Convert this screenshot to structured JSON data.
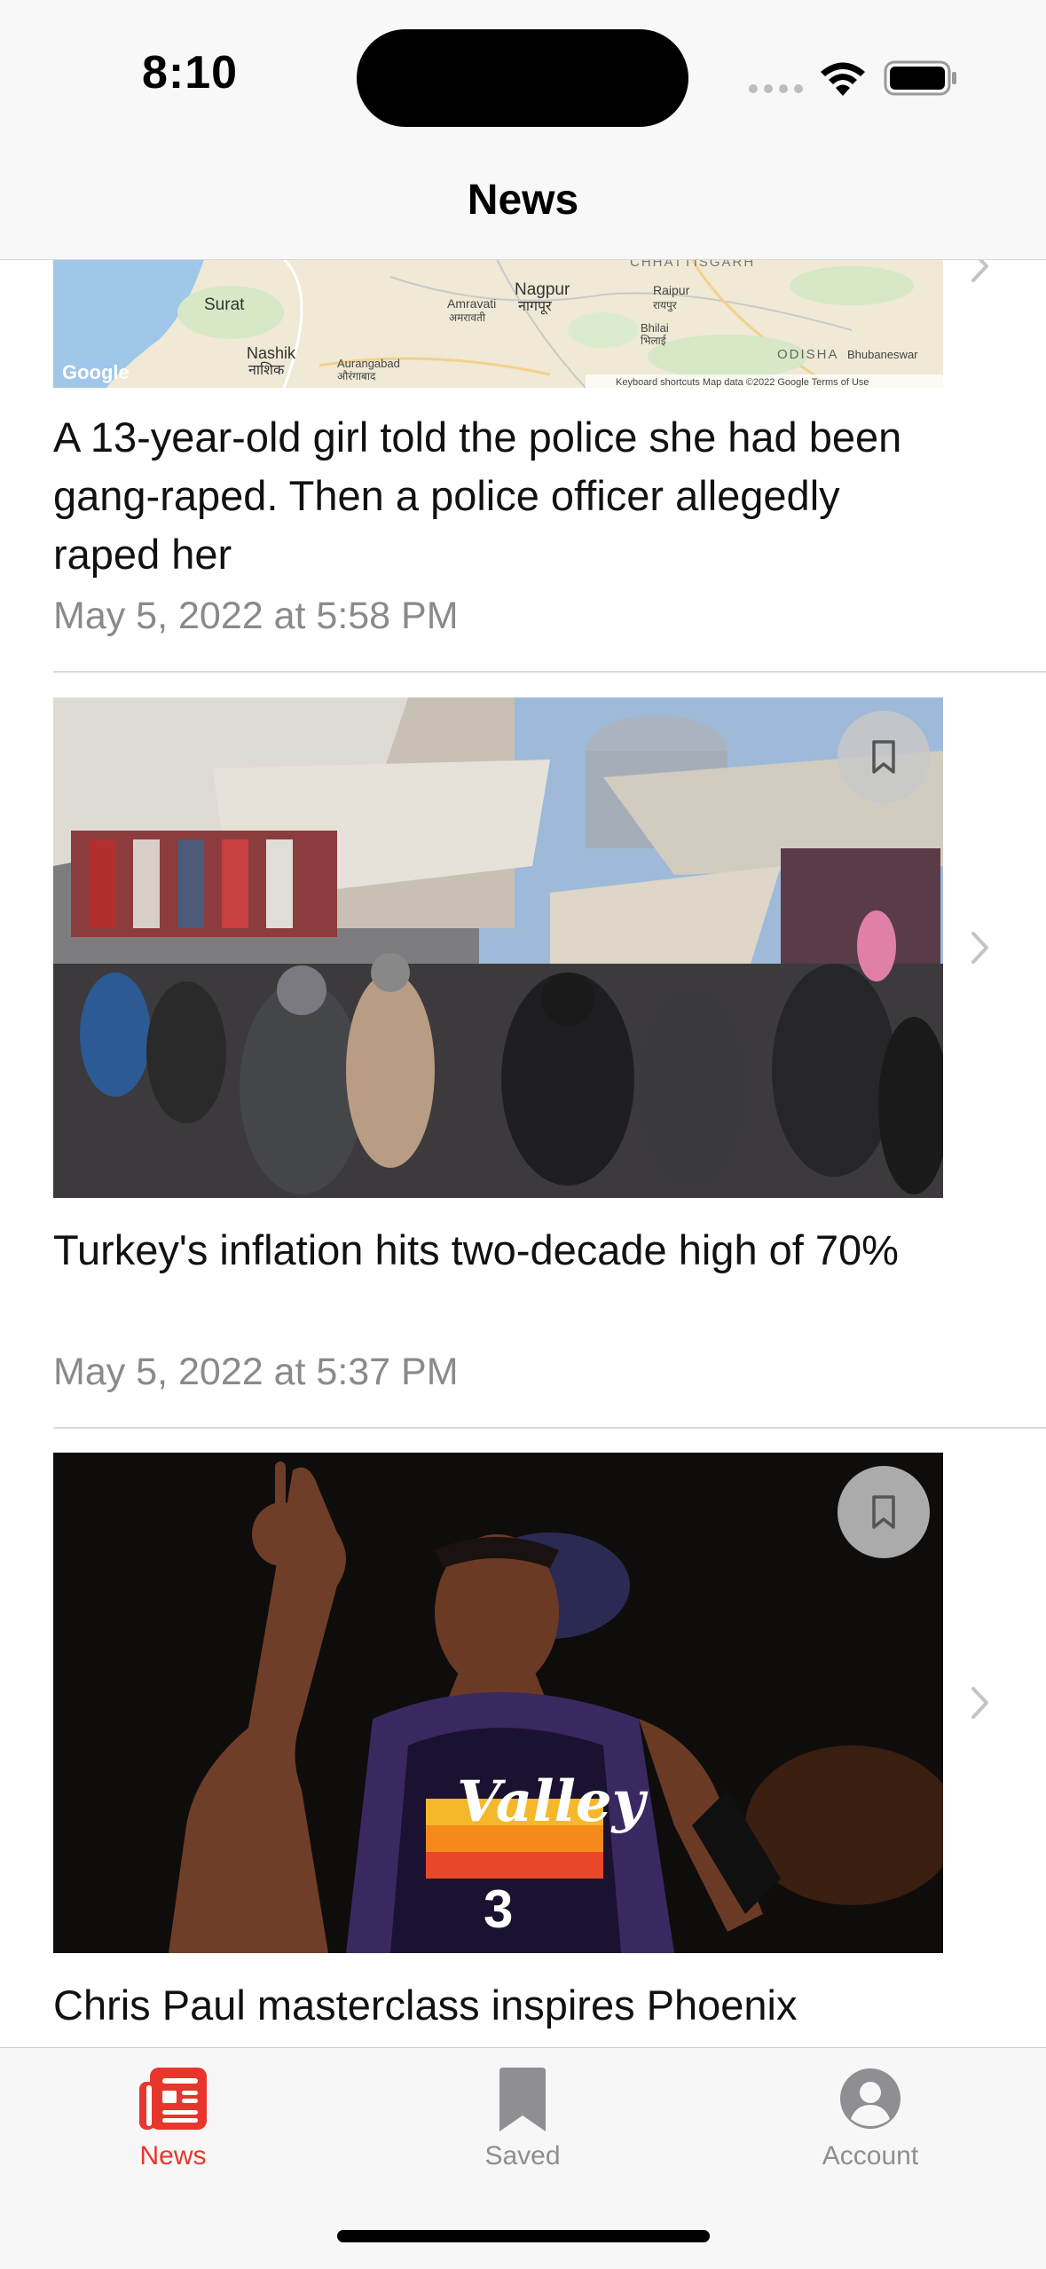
{
  "status_bar": {
    "time": "8:10"
  },
  "nav": {
    "title": "News"
  },
  "articles": [
    {
      "headline": "A 13-year-old girl told the police she had been gang-raped. Then a police officer allegedly raped her",
      "date": "May 5, 2022 at 5:58 PM",
      "image": "map-image",
      "map_labels": {
        "surat": "Surat",
        "nagpur": "Nagpur",
        "nagpur_local": "नागपूर",
        "amravati": "Amravati",
        "amravati_local": "अमरावती",
        "raipur": "Raipur",
        "raipur_local": "रायपुर",
        "bhilai": "Bhilai",
        "bhilai_local": "भिलाई",
        "nashik": "Nashik",
        "nashik_local": "नाशिक",
        "aurangabad": "Aurangabad",
        "aurangabad_local": "औरंगाबाद",
        "chhattisgarh": "CHHATTISGARH",
        "odisha": "ODISHA",
        "bhubaneswar": "Bhubaneswar",
        "google": "Google",
        "attribution": "Keyboard shortcuts   Map data ©2022 Google   Terms of Use"
      }
    },
    {
      "headline": "Turkey's inflation hits two-decade high of 70%",
      "date": "May 5, 2022 at 5:37 PM",
      "image": "market-photo"
    },
    {
      "headline": "Chris Paul masterclass inspires Phoenix",
      "image": "basketball-photo",
      "jersey_text": "Valley",
      "jersey_number": "3"
    }
  ],
  "tabs": [
    {
      "label": "News",
      "icon": "newspaper-icon",
      "active": true
    },
    {
      "label": "Saved",
      "icon": "bookmark-icon",
      "active": false
    },
    {
      "label": "Account",
      "icon": "person-circle-icon",
      "active": false
    }
  ],
  "colors": {
    "accent": "#e8362d",
    "inactive": "#8e8e93",
    "date": "#8a8a8e"
  }
}
